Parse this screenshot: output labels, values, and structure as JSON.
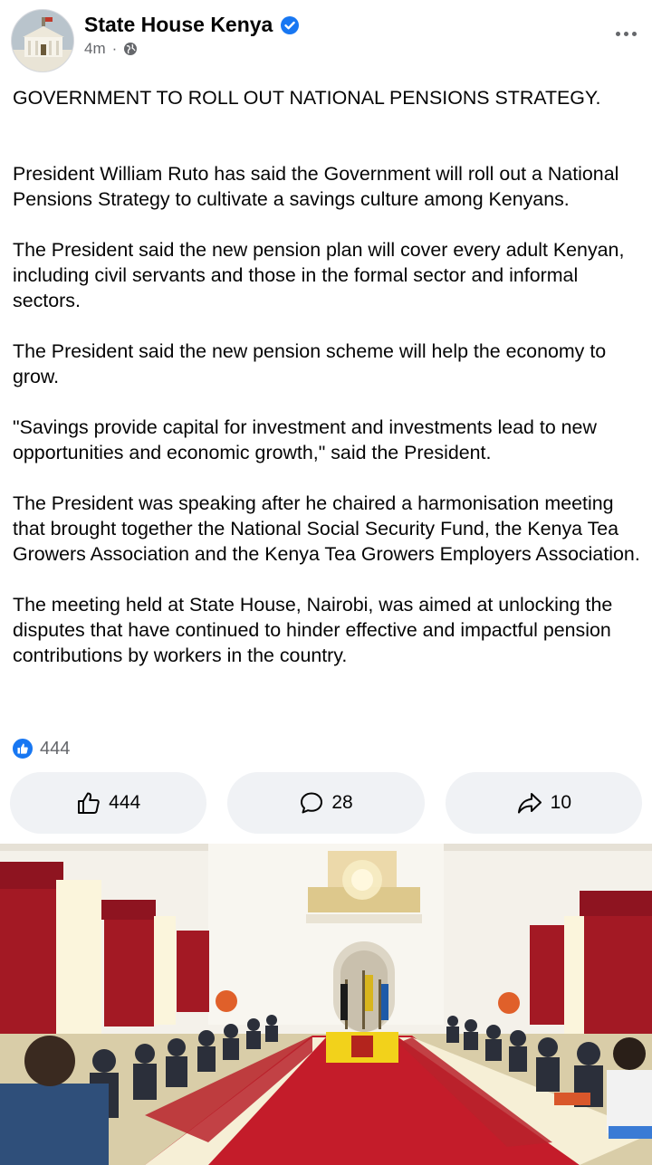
{
  "header": {
    "page_name": "State House Kenya",
    "timestamp": "4m",
    "separator": "·",
    "verified_icon": "verified-badge-icon",
    "privacy_icon": "globe-icon",
    "more_icon": "more-options-icon"
  },
  "post": {
    "headline": "GOVERNMENT TO ROLL OUT NATIONAL PENSIONS STRATEGY.",
    "paragraphs": [
      "President William Ruto has said the Government will roll out a National Pensions Strategy to cultivate a savings culture among Kenyans.",
      "The President said the new pension plan will cover every adult Kenyan, including civil servants and those in the formal sector and informal sectors.",
      "The President said the new pension scheme will help the economy to grow.",
      "\"Savings provide capital for investment and investments lead to new opportunities and economic growth,\" said the President.",
      "The President was speaking after he chaired a harmonisation meeting that brought together the National Social Security Fund, the Kenya Tea Growers Association and the Kenya Tea Growers Employers Association.",
      "The meeting held at State House, Nairobi, was aimed at unlocking the disputes that have continued to hinder effective and impactful pension contributions by workers in the country."
    ]
  },
  "reactions": {
    "like_count": "444"
  },
  "actions": {
    "like": {
      "label": "444",
      "icon": "thumbs-up-icon"
    },
    "comment": {
      "label": "28",
      "icon": "comment-bubble-icon"
    },
    "share": {
      "label": "10",
      "icon": "share-arrow-icon"
    }
  },
  "colors": {
    "accent": "#1877f2",
    "secondary_text": "#65676b",
    "button_bg": "#f0f2f5",
    "carpet_red": "#c41c2a",
    "table_yellow": "#f2d21b"
  }
}
